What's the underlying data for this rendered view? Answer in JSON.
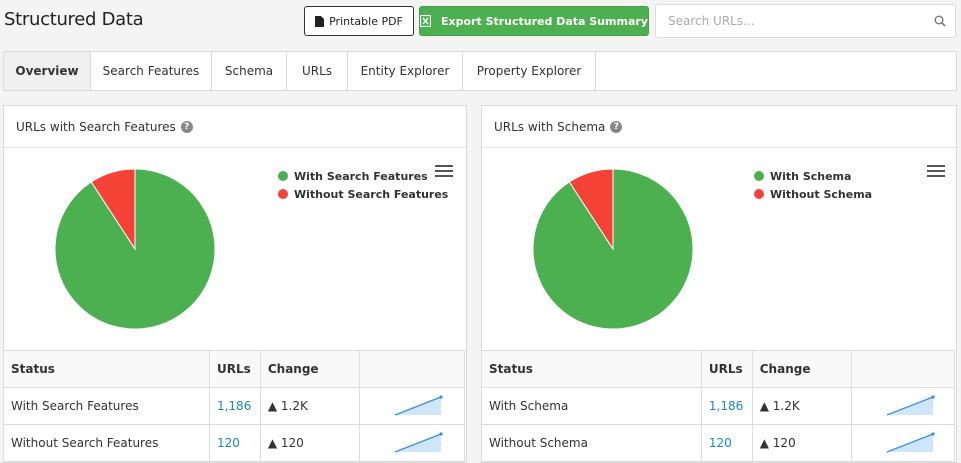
{
  "page": {
    "title": "Structured Data"
  },
  "toolbar": {
    "pdf_label": "Printable PDF",
    "export_label": "Export Structured Data Summary",
    "search_placeholder": "Search URLs..."
  },
  "tabs": [
    {
      "label": "Overview",
      "active": true
    },
    {
      "label": "Search Features"
    },
    {
      "label": "Schema"
    },
    {
      "label": "URLs"
    },
    {
      "label": "Entity Explorer"
    },
    {
      "label": "Property Explorer"
    }
  ],
  "panels": [
    {
      "title": "URLs with Search Features",
      "legend": [
        "With Search Features",
        "Without Search Features"
      ],
      "table": {
        "headers": [
          "Status",
          "URLs",
          "Change"
        ],
        "rows": [
          {
            "status": "With Search Features",
            "urls": "1,186",
            "change": "▲ 1.2K"
          },
          {
            "status": "Without Search Features",
            "urls": "120",
            "change": "▲ 120"
          }
        ]
      }
    },
    {
      "title": "URLs with Schema",
      "legend": [
        "With Schema",
        "Without Schema"
      ],
      "table": {
        "headers": [
          "Status",
          "URLs",
          "Change"
        ],
        "rows": [
          {
            "status": "With Schema",
            "urls": "1,186",
            "change": "▲ 1.2K"
          },
          {
            "status": "Without Schema",
            "urls": "120",
            "change": "▲ 120"
          }
        ]
      }
    }
  ],
  "chart_data": [
    {
      "type": "pie",
      "categories": [
        "With Search Features",
        "Without Search Features"
      ],
      "values": [
        1186,
        120
      ],
      "colors": [
        "#4caf50",
        "#f44336"
      ]
    },
    {
      "type": "pie",
      "categories": [
        "With Schema",
        "Without Schema"
      ],
      "values": [
        1186,
        120
      ],
      "colors": [
        "#4caf50",
        "#f44336"
      ]
    }
  ]
}
